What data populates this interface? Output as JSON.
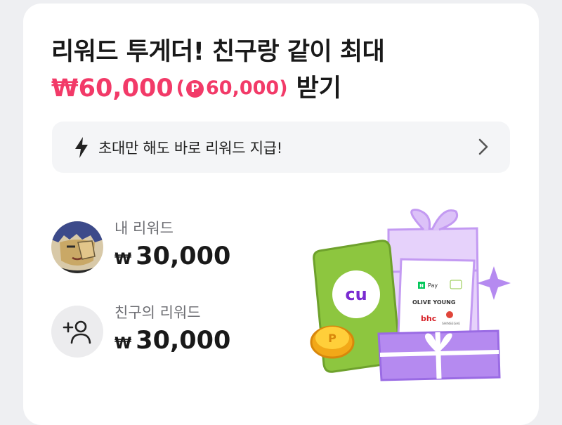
{
  "headline": {
    "line1": "리워드 투게더! 친구랑 같이 최대",
    "amount": "₩60,000",
    "paren_open": "(",
    "point_symbol": "P",
    "point_amount": "60,000",
    "paren_close": ")",
    "suffix": "받기"
  },
  "banner": {
    "text": "초대만 해도 바로 리워드 지급!"
  },
  "my_reward": {
    "label": "내 리워드",
    "currency": "₩",
    "amount": "30,000"
  },
  "friend_reward": {
    "label": "친구의 리워드",
    "currency": "₩",
    "amount": "30,000"
  },
  "illustration": {
    "coupon_logo": "cu",
    "npay_badge": "N",
    "npay_label": "Pay",
    "brand_2": "OLIVE YOUNG",
    "brand_3": "bhc",
    "brand_4": "SHINSEGAE",
    "coin_symbol": "P"
  },
  "colors": {
    "accent": "#f23a68",
    "green": "#8dc63f",
    "purple": "#b58af0"
  }
}
